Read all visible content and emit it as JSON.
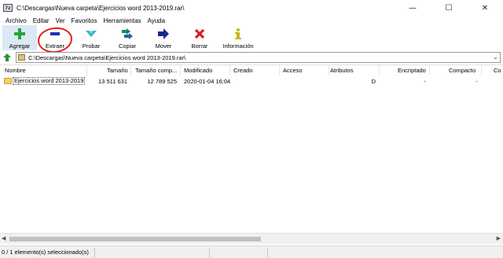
{
  "window": {
    "title": "C:\\Descargas\\Nueva carpeta\\Ejercicios word 2013-2019.rar\\",
    "app_icon": "7z",
    "minimize_glyph": "—",
    "maximize_glyph": "☐",
    "close_glyph": "✕"
  },
  "menu": {
    "items": [
      {
        "label": "Archivo"
      },
      {
        "label": "Editar"
      },
      {
        "label": "Ver"
      },
      {
        "label": "Favoritos"
      },
      {
        "label": "Herramientas"
      },
      {
        "label": "Ayuda"
      }
    ]
  },
  "toolbar": {
    "buttons": [
      {
        "label": "Agregar",
        "icon": "plus-icon",
        "color": "#21a833"
      },
      {
        "label": "Extraer",
        "icon": "minus-icon",
        "color": "#1d2fb8"
      },
      {
        "label": "Probar",
        "icon": "test-chevron-icon",
        "color": "#39b3c9"
      },
      {
        "label": "Copiar",
        "icon": "copy-arrows-icon",
        "color": "#17885a"
      },
      {
        "label": "Mover",
        "icon": "move-arrow-icon",
        "color": "#172a8c"
      },
      {
        "label": "Borrar",
        "icon": "delete-x-icon",
        "color": "#d42121"
      },
      {
        "label": "Información",
        "icon": "info-icon",
        "color": "#c9b60b"
      }
    ]
  },
  "address": {
    "path": "C:\\Descargas\\Nueva carpeta\\Ejercicios word 2013-2019.rar\\"
  },
  "table": {
    "columns": [
      "Nombre",
      "Tamaño",
      "Tamaño comp...",
      "Modificado",
      "Creado",
      "Acceso",
      "Atributos",
      "Encriptado",
      "Compacto",
      "Co"
    ],
    "rows": [
      {
        "name": "Ejercicios word 2013-2019",
        "size": "13 511 631",
        "packed": "12 789 525",
        "modified": "2020-01-04 16:04",
        "created": "",
        "accessed": "",
        "attributes": "D",
        "encrypted": "-",
        "solid": "-"
      }
    ]
  },
  "status": {
    "selection": "0 / 1 elemento(s) seleccionado(s)"
  },
  "annotation": {
    "circle_color": "#e0221f"
  }
}
